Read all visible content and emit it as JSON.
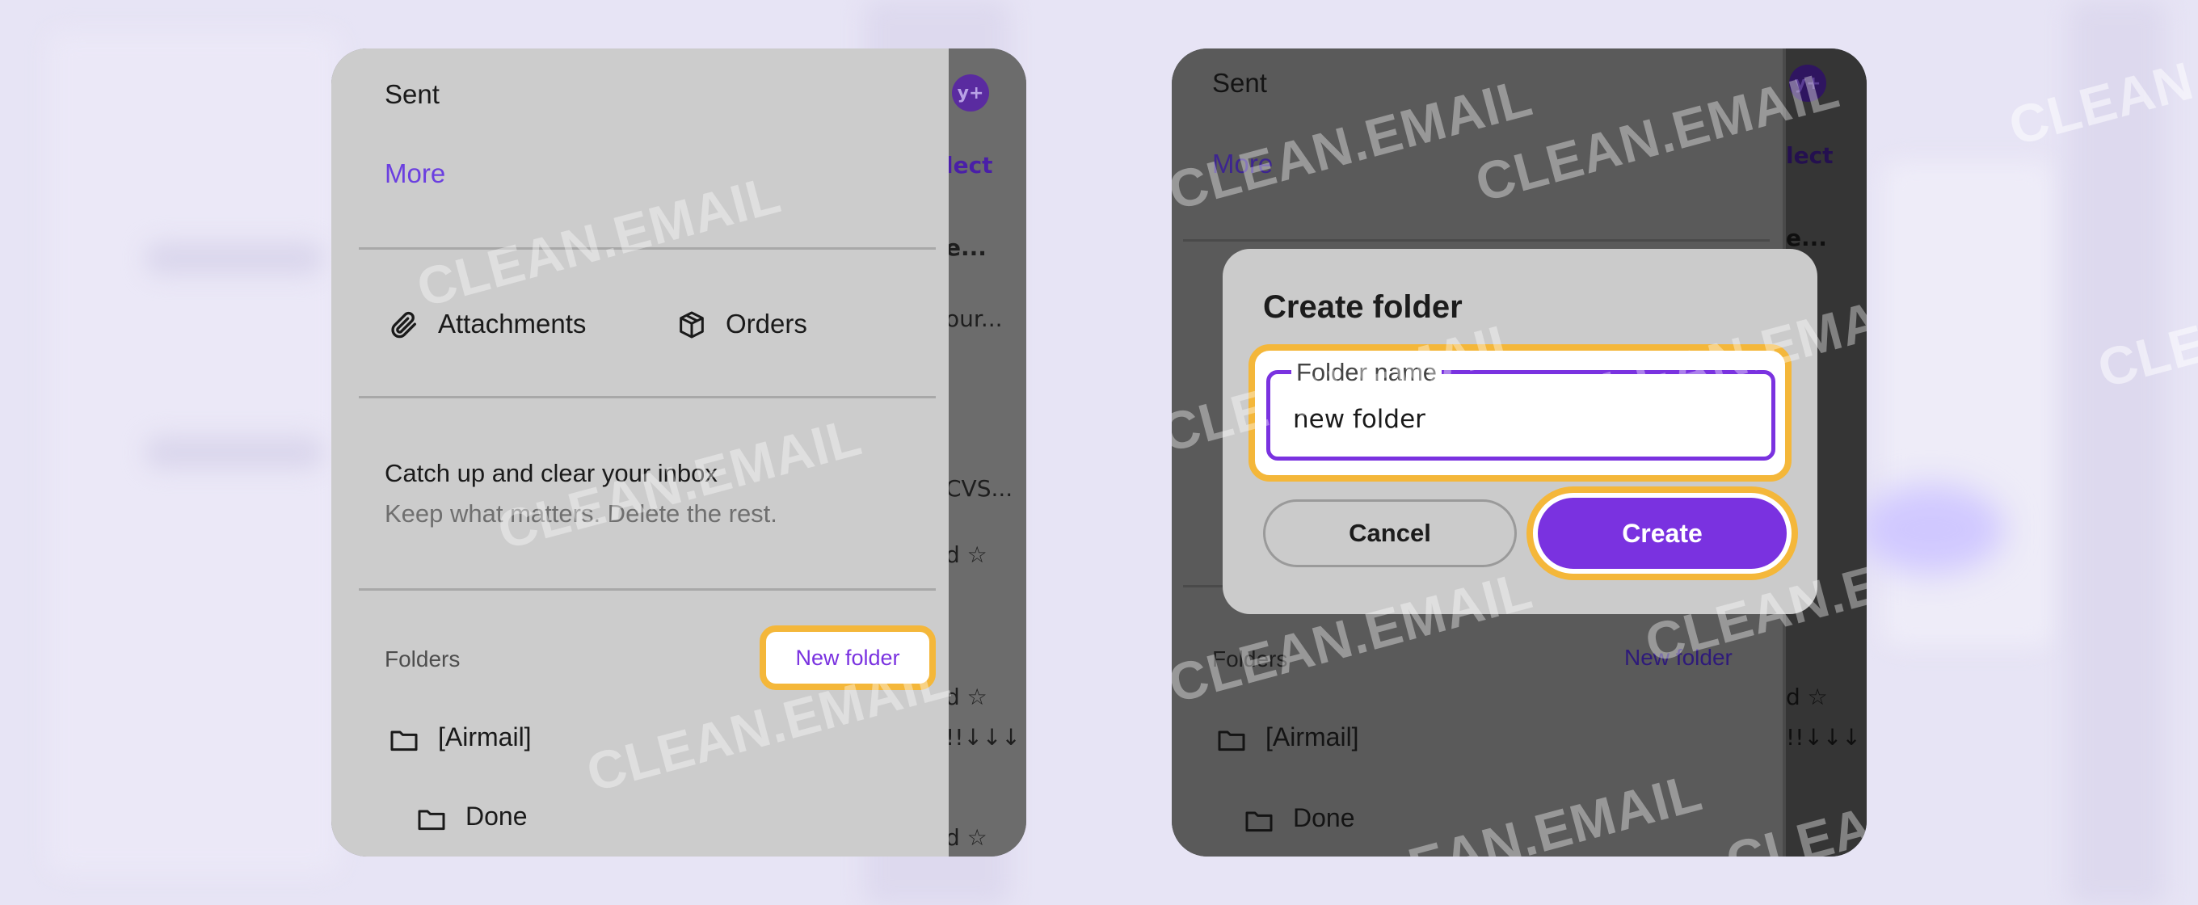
{
  "watermark": "CLEAN.EMAIL",
  "colors": {
    "accent": "#7a32e0",
    "highlight": "#f4b73a",
    "background": "#e7e4f5"
  },
  "drawer": {
    "sent": "Sent",
    "more": "More",
    "attachments": "Attachments",
    "orders": "Orders",
    "promo_title": "Catch up and clear your inbox",
    "promo_subtitle": "Keep what matters. Delete the rest.",
    "folders_label": "Folders",
    "new_folder": "New folder",
    "folders": [
      "[Airmail]",
      "Done"
    ]
  },
  "mail_peek": {
    "avatar": "y+",
    "select": "lect",
    "lines": [
      "e...",
      "our...",
      "CVS...",
      "d ☆",
      "d ☆",
      "!!↓↓↓",
      "d ☆"
    ]
  },
  "dialog": {
    "title": "Create folder",
    "field_label": "Folder name",
    "field_value": "new folder",
    "cancel": "Cancel",
    "create": "Create"
  }
}
